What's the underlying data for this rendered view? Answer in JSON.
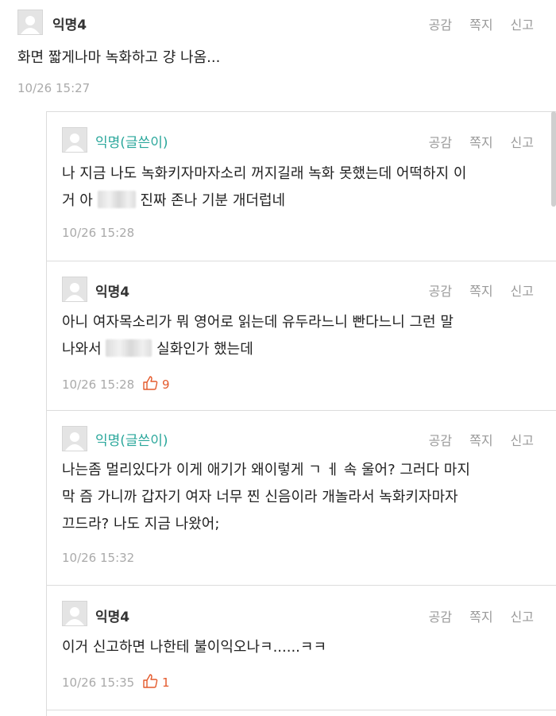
{
  "actions": {
    "like": "공감",
    "message": "쪽지",
    "report": "신고"
  },
  "comments": [
    {
      "author": "익명4",
      "lines": [
        "화면 짧게나마 녹화하고 걍 나옴..."
      ],
      "time": "10/26 15:27"
    },
    {
      "author": "익명(글쓴이)",
      "line1": "나 지금 나도 녹화키자마자소리 꺼지길래 녹화 못했는데 어떡하지 이",
      "line2_pre": "거 아",
      "line2_post": "진짜 존나 기분 개더럽네",
      "time": "10/26 15:28"
    },
    {
      "author": "익명4",
      "line1": "아니 여자목소리가 뭐 영어로 읽는데 유두라느니 빤다느니 그런 말",
      "line2_pre": "나와서",
      "line2_post": "실화인가 했는데",
      "time": "10/26 15:28",
      "likes": "9"
    },
    {
      "author": "익명(글쓴이)",
      "lines": [
        "나는좀 멀리있다가 이게 애기가 왜이렇게 ㄱ ㅔ 속 울어? 그러다 마지",
        "막 즘 가니까 갑자기 여자 너무 찐 신음이라 개놀라서 녹화키자마자",
        "끄드라? 나도 지금 나왔어;"
      ],
      "time": "10/26 15:32"
    },
    {
      "author": "익명4",
      "lines": [
        "이거 신고하면 나한테 불이익오나ㅋ......ㅋㅋ"
      ],
      "time": "10/26 15:35",
      "likes": "1"
    }
  ],
  "colors": {
    "op_name": "#2aa79b",
    "like": "#e45a2c",
    "meta": "#aaaaaa"
  }
}
